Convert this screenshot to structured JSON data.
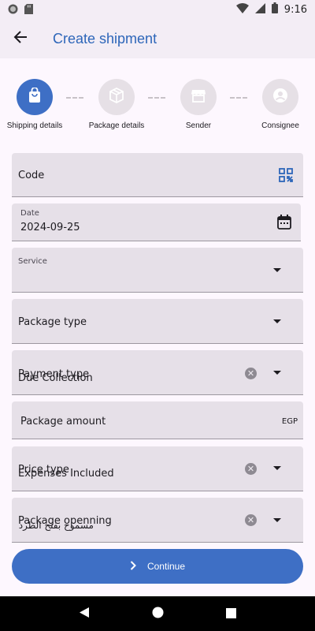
{
  "status_bar": {
    "time": "9:16",
    "left_icons": [
      "record-icon",
      "sd-card-icon"
    ],
    "right_icons": [
      "wifi-icon",
      "signal-icon",
      "battery-icon"
    ]
  },
  "app_bar": {
    "title": "Create shipment",
    "back_icon": "arrow-back-icon"
  },
  "stepper": {
    "steps": [
      {
        "label": "Shipping details",
        "icon": "shopping-bag-icon",
        "active": true
      },
      {
        "label": "Package details",
        "icon": "package-icon",
        "active": false
      },
      {
        "label": "Sender",
        "icon": "store-icon",
        "active": false
      },
      {
        "label": "Consignee",
        "icon": "person-icon",
        "active": false
      }
    ]
  },
  "form": {
    "code": {
      "label": "Code",
      "icon": "qr-code-icon"
    },
    "date": {
      "label": "Date",
      "value": "2024-09-25",
      "icon": "calendar-icon"
    },
    "service": {
      "label": "Service",
      "value": ""
    },
    "package_type": {
      "label": "Package type"
    },
    "payment_type": {
      "label": "Payment type",
      "value": "Due Collection"
    },
    "package_amount": {
      "label": "Package amount",
      "suffix": "EGP"
    },
    "price_type": {
      "label": "Price type",
      "value": "Expenses Included"
    },
    "package_opening": {
      "label": "Package openning",
      "value": "مسموح بفتح الطرد"
    }
  },
  "continue_button": {
    "label": "Continue",
    "icon": "chevron-right-icon"
  },
  "nav_bar": {
    "icons": [
      "back-triangle-icon",
      "home-circle-icon",
      "recents-square-icon"
    ]
  },
  "colors": {
    "primary": "#3e6fc5",
    "title": "#2d66b9",
    "field_bg": "#e6e0e8",
    "background": "#fdf7fe"
  }
}
